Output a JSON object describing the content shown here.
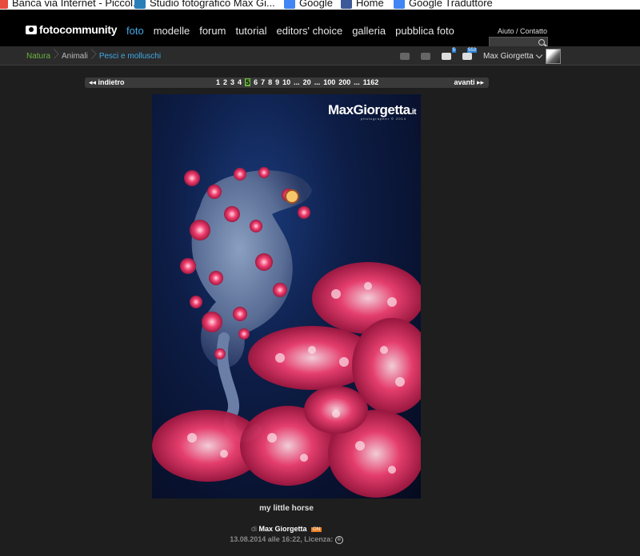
{
  "bookmarks": [
    {
      "label": "Banca via Internet - Piccol...",
      "icon": "bank-icon",
      "color": "#e74c3c"
    },
    {
      "label": "Studio fotografico Max Gi...",
      "icon": "page-icon",
      "color": "#2980b9"
    },
    {
      "label": "Google",
      "icon": "google-icon",
      "color": "#4285f4"
    },
    {
      "label": "Home",
      "icon": "facebook-icon",
      "color": "#3b5998"
    },
    {
      "label": "Google Traduttore",
      "icon": "translate-icon",
      "color": "#4285f4"
    }
  ],
  "header": {
    "logo": "fotocommunity",
    "nav": [
      "foto",
      "modelle",
      "forum",
      "tutorial",
      "editors' choice",
      "galleria",
      "pubblica foto"
    ],
    "help": "Aiuto / Contatto",
    "search_placeholder": ""
  },
  "breadcrumb": [
    "Natura",
    "Animali",
    "Pesci e molluschi"
  ],
  "usertools": {
    "badge1": "5",
    "badge2": "553",
    "username": "Max Giorgetta"
  },
  "pager": {
    "prev": "indietro",
    "next": "avanti",
    "pages": [
      "1",
      "2",
      "3",
      "4",
      "5",
      "6",
      "7",
      "8",
      "9",
      "10",
      "...",
      "20",
      "...",
      "100",
      "200",
      "...",
      "1162"
    ],
    "current": "5"
  },
  "photo": {
    "watermark": "MaxGiorgetta",
    "watermark_tld": ".it",
    "watermark_sub": "photographer © 2014"
  },
  "caption": "my little horse",
  "author": {
    "prefix": "di",
    "name": "Max Giorgetta",
    "tag": "ON"
  },
  "date": "13.08.2014 alle 16:22, Licenza:",
  "license_icon": "©",
  "colors": {
    "accent_blue": "#3fa9e6",
    "accent_green": "#6cb33f",
    "tag_orange": "#e67e22"
  }
}
